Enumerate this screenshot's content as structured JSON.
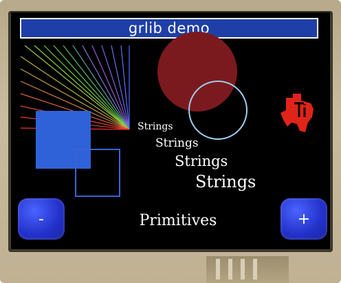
{
  "app": {
    "title": "grlib demo"
  },
  "primitives": {
    "strings": [
      "Strings",
      "Strings",
      "Strings",
      "Strings"
    ]
  },
  "footer": {
    "prev_label": "-",
    "mode_label": "Primitives",
    "next_label": "+"
  },
  "colors": {
    "title_bar": "#1f3fa8",
    "button": "#2231c8",
    "filled_rect": "#2f62d8",
    "outline_rect": "#3b62d8",
    "filled_circle": "#7a1a1f",
    "outline_circle": "#9fd0f0",
    "logo": "#e0241a"
  },
  "icons": {
    "logo": "ti-logo-icon"
  }
}
